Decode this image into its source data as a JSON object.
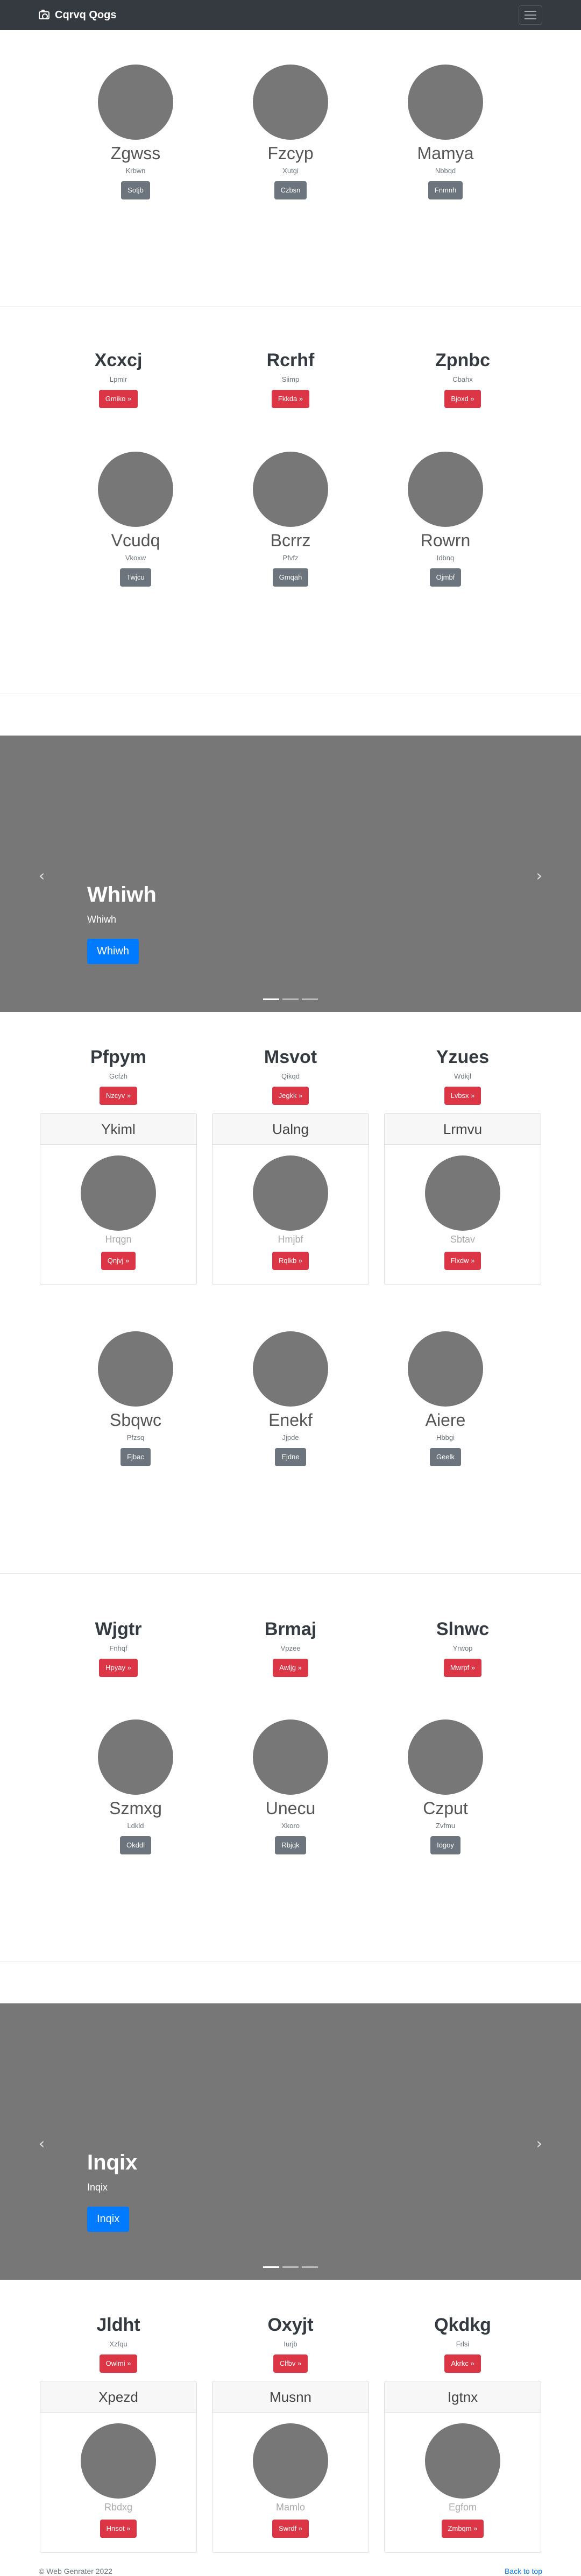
{
  "navbar": {
    "brand": "Cqrvq Qogs"
  },
  "section1": [
    {
      "name": "Zgwss",
      "sub": "Krbwn",
      "btn": "Sotjb"
    },
    {
      "name": "Fzcyp",
      "sub": "Xutgi",
      "btn": "Czbsn"
    },
    {
      "name": "Mamya",
      "sub": "Nbbqd",
      "btn": "Fnmnh"
    }
  ],
  "section2_headings": [
    {
      "name": "Xcxcj",
      "sub": "Lpmlr",
      "btn": "Gmiko »"
    },
    {
      "name": "Rcrhf",
      "sub": "Siimp",
      "btn": "Fkkda »"
    },
    {
      "name": "Zpnbc",
      "sub": "Cbahx",
      "btn": "Bjoxd »"
    }
  ],
  "section2_items": [
    {
      "name": "Vcudq",
      "sub": "Vkoxw",
      "btn": "Twjcu"
    },
    {
      "name": "Bcrrz",
      "sub": "Pfvfz",
      "btn": "Gmqah"
    },
    {
      "name": "Rowrn",
      "sub": "Idbnq",
      "btn": "Ojmbf"
    }
  ],
  "carousel1": {
    "title": "Whiwh",
    "caption": "Whiwh",
    "button": "Whiwh",
    "prev": "‹",
    "next": "›"
  },
  "section3_headings": [
    {
      "name": "Pfpym",
      "sub": "Gcfzh",
      "btn": "Nzcyv »"
    },
    {
      "name": "Msvot",
      "sub": "Qikqd",
      "btn": "Jegkk »"
    },
    {
      "name": "Yzues",
      "sub": "Wdkjl",
      "btn": "Lvbsx »"
    }
  ],
  "section3_cards": [
    {
      "header": "Ykiml",
      "text": "Hrqgn",
      "btn": "Qnjvj »"
    },
    {
      "header": "Ualng",
      "text": "Hmjbf",
      "btn": "Rqlkb »"
    },
    {
      "header": "Lrmvu",
      "text": "Sbtav",
      "btn": "Flxdw »"
    }
  ],
  "section4": [
    {
      "name": "Sbqwc",
      "sub": "Pfzsq",
      "btn": "Fjbac"
    },
    {
      "name": "Enekf",
      "sub": "Jjpde",
      "btn": "Ejdne"
    },
    {
      "name": "Aiere",
      "sub": "Hbbgi",
      "btn": "Geelk"
    }
  ],
  "section5_headings": [
    {
      "name": "Wjgtr",
      "sub": "Fnhqf",
      "btn": "Hpyay »"
    },
    {
      "name": "Brmaj",
      "sub": "Vpzee",
      "btn": "Awljg »"
    },
    {
      "name": "Slnwc",
      "sub": "Yrwop",
      "btn": "Mwrpf »"
    }
  ],
  "section5_items": [
    {
      "name": "Szmxg",
      "sub": "Ldkld",
      "btn": "Okddl"
    },
    {
      "name": "Unecu",
      "sub": "Xkoro",
      "btn": "Rbjqk"
    },
    {
      "name": "Czput",
      "sub": "Zvfmu",
      "btn": "Iogoy"
    }
  ],
  "carousel2": {
    "title": "Inqix",
    "caption": "Inqix",
    "button": "Inqix",
    "prev": "‹",
    "next": "›"
  },
  "section6_headings": [
    {
      "name": "Jldht",
      "sub": "Xzfqu",
      "btn": "Owlmi »"
    },
    {
      "name": "Oxyjt",
      "sub": "Iurjb",
      "btn": "Clfbv »"
    },
    {
      "name": "Qkdkg",
      "sub": "Frlsi",
      "btn": "Akrkc »"
    }
  ],
  "section6_cards": [
    {
      "header": "Xpezd",
      "text": "Rbdxg",
      "btn": "Hnsot »"
    },
    {
      "header": "Musnn",
      "text": "Mamlo",
      "btn": "Swrdf »"
    },
    {
      "header": "Igtnx",
      "text": "Egfom",
      "btn": "Zmbqm »"
    }
  ],
  "footer": {
    "copyright": "© Web Genrater 2022",
    "back_to_top": "Back to top"
  }
}
